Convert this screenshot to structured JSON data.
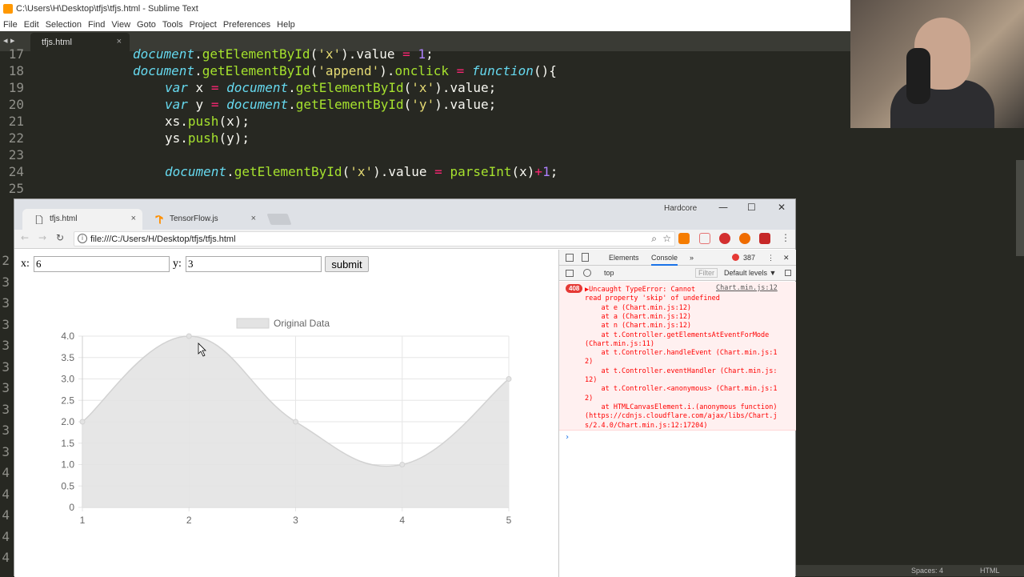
{
  "editor": {
    "title": "C:\\Users\\H\\Desktop\\tfjs\\tfjs.html - Sublime Text",
    "menu": [
      "File",
      "Edit",
      "Selection",
      "Find",
      "View",
      "Goto",
      "Tools",
      "Project",
      "Preferences",
      "Help"
    ],
    "tab_name": "tfjs.html",
    "tab_close": "×",
    "nav_arrows": "◂ ▸",
    "gutter_hidden": [
      "2",
      "3",
      "3",
      "3",
      "3",
      "3",
      "3",
      "3",
      "3",
      "3",
      "4",
      "4",
      "4",
      "4",
      "4"
    ],
    "status_spaces": "Spaces: 4",
    "status_syntax": "HTML",
    "lines": [
      {
        "n": "17",
        "indent": "    ",
        "parts": [
          [
            "it",
            "document"
          ],
          [
            "",
            "."
          ],
          [
            "fn",
            "getElementById"
          ],
          [
            "",
            "("
          ],
          [
            "st",
            "'x'"
          ],
          [
            "",
            ")."
          ],
          [
            "",
            "value "
          ],
          [
            "op",
            "="
          ],
          [
            "",
            ""
          ],
          [
            "nm",
            " 1"
          ],
          [
            "",
            ";"
          ]
        ]
      },
      {
        "n": "18",
        "indent": "    ",
        "parts": [
          [
            "it",
            "document"
          ],
          [
            "",
            "."
          ],
          [
            "fn",
            "getElementById"
          ],
          [
            "",
            "("
          ],
          [
            "st",
            "'append'"
          ],
          [
            "",
            ")."
          ],
          [
            "fn",
            "onclick"
          ],
          [
            "op",
            " = "
          ],
          [
            "kw",
            "function"
          ],
          [
            "",
            "(){"
          ]
        ]
      },
      {
        "n": "19",
        "indent": "        ",
        "parts": [
          [
            "kw",
            "var"
          ],
          [
            "",
            " x "
          ],
          [
            "op",
            "="
          ],
          [
            "",
            " "
          ],
          [
            "it",
            "document"
          ],
          [
            "",
            "."
          ],
          [
            "fn",
            "getElementById"
          ],
          [
            "",
            "("
          ],
          [
            "st",
            "'x'"
          ],
          [
            "",
            ").value;"
          ]
        ]
      },
      {
        "n": "20",
        "indent": "        ",
        "parts": [
          [
            "kw",
            "var"
          ],
          [
            "",
            " y "
          ],
          [
            "op",
            "="
          ],
          [
            "",
            " "
          ],
          [
            "it",
            "document"
          ],
          [
            "",
            "."
          ],
          [
            "fn",
            "getElementById"
          ],
          [
            "",
            "("
          ],
          [
            "st",
            "'y'"
          ],
          [
            "",
            ").value;"
          ]
        ]
      },
      {
        "n": "21",
        "indent": "        ",
        "parts": [
          [
            "",
            "xs."
          ],
          [
            "fn",
            "push"
          ],
          [
            "",
            "(x);"
          ]
        ]
      },
      {
        "n": "22",
        "indent": "        ",
        "parts": [
          [
            "",
            "ys."
          ],
          [
            "fn",
            "push"
          ],
          [
            "",
            "(y);"
          ]
        ]
      },
      {
        "n": "23",
        "indent": "",
        "parts": []
      },
      {
        "n": "24",
        "indent": "        ",
        "parts": [
          [
            "it",
            "document"
          ],
          [
            "",
            "."
          ],
          [
            "fn",
            "getElementById"
          ],
          [
            "",
            "("
          ],
          [
            "st",
            "'x'"
          ],
          [
            "",
            ").value "
          ],
          [
            "op",
            "="
          ],
          [
            "",
            " "
          ],
          [
            "fn",
            "parseInt"
          ],
          [
            "",
            "(x)"
          ],
          [
            "op",
            "+"
          ],
          [
            "nm",
            "1"
          ],
          [
            "",
            ";"
          ]
        ]
      },
      {
        "n": "25",
        "indent": "",
        "parts": []
      }
    ]
  },
  "browser": {
    "tabs": [
      {
        "label": "tfjs.html",
        "close": "×"
      },
      {
        "label": "TensorFlow.js",
        "close": "×"
      }
    ],
    "user": "Hardcore",
    "window_controls": [
      "—",
      "☐",
      "✕"
    ],
    "url": "file:///C:/Users/H/Desktop/tfjs/tfjs.html",
    "info_glyph": "i",
    "nav_back": "←",
    "nav_forward": "→",
    "nav_reload": "↻",
    "menu_dots": "⋮",
    "zoom_glyph": "⌕",
    "star_glyph": "☆"
  },
  "page": {
    "x_label": "x:",
    "x_value": "6",
    "y_label": "y:",
    "y_value": "3",
    "submit_label": "submit"
  },
  "chart_data": {
    "type": "line",
    "x": [
      1,
      2,
      3,
      4,
      5
    ],
    "series": [
      {
        "name": "Original Data",
        "values": [
          2,
          4,
          2,
          1,
          3
        ]
      }
    ],
    "x_ticks": [
      "1",
      "2",
      "3",
      "4",
      "5"
    ],
    "y_ticks": [
      "0",
      "0.5",
      "1.0",
      "1.5",
      "2.0",
      "2.5",
      "3.0",
      "3.5",
      "4.0"
    ],
    "xlim": [
      1,
      5
    ],
    "ylim": [
      0,
      4
    ],
    "grid": true,
    "fill": true,
    "legend": "top",
    "colors": {
      "fill": "#e3e3e3",
      "line": "#d2d2d2",
      "grid": "#e6e6e6"
    }
  },
  "devtools": {
    "tabs": [
      "Elements",
      "Console",
      "»"
    ],
    "error_count": "387",
    "context": "top",
    "filter_placeholder": "Filter",
    "levels": "Default levels ▼",
    "error_badge": "408",
    "error_lines": [
      "▶Uncaught TypeError: Cannot",
      "read property 'skip' of undefined",
      "    at e (Chart.min.js:12)",
      "    at a (Chart.min.js:12)",
      "    at n (Chart.min.js:12)",
      "    at t.Controller.getElementsAtEventForMode",
      "(Chart.min.js:11)",
      "    at t.Controller.handleEvent (Chart.min.js:1",
      "2)",
      "    at t.Controller.eventHandler (Chart.min.js:",
      "12)",
      "    at t.Controller.<anonymous> (Chart.min.js:1",
      "2)",
      "    at HTMLCanvasElement.i.(anonymous function)",
      "(https://cdnjs.cloudflare.com/ajax/libs/Chart.j",
      "s/2.4.0/Chart.min.js:12:17204)"
    ],
    "error_source": "Chart.min.js:12",
    "prompt": "›"
  }
}
